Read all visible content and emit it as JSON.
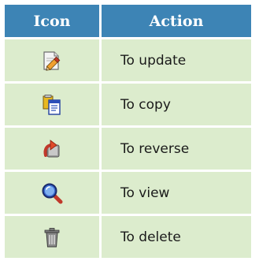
{
  "table": {
    "headers": {
      "icon": "Icon",
      "action": "Action"
    },
    "rows": [
      {
        "icon": "edit-pencil-icon",
        "label": "To update"
      },
      {
        "icon": "copy-documents-icon",
        "label": "To copy"
      },
      {
        "icon": "reverse-arrow-icon",
        "label": "To reverse"
      },
      {
        "icon": "magnifier-view-icon",
        "label": "To view"
      },
      {
        "icon": "trash-can-icon",
        "label": "To delete"
      }
    ]
  },
  "colors": {
    "header_bg": "#3d84b5",
    "header_text": "#ffffff",
    "row_bg": "#dceccd",
    "row_text": "#1a1a1a"
  }
}
